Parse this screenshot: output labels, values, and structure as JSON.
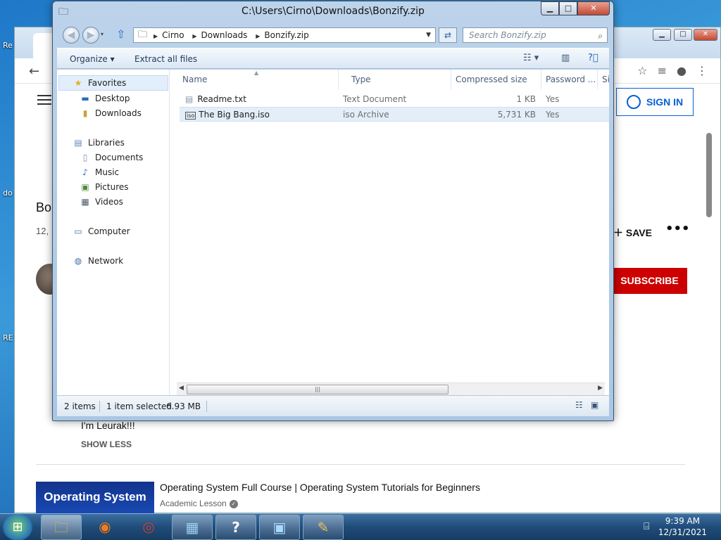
{
  "window": {
    "title": "C:\\Users\\Cirno\\Downloads\\Bonzify.zip",
    "minimize": "▁",
    "maximize": "□",
    "close": "✕"
  },
  "breadcrumb": [
    "Cirno",
    "Downloads",
    "Bonzify.zip"
  ],
  "search": {
    "placeholder": "Search Bonzify.zip"
  },
  "commands": {
    "organize": "Organize ▾",
    "extract_all": "Extract all files"
  },
  "nav": {
    "favorites": "Favorites",
    "desktop": "Desktop",
    "downloads": "Downloads",
    "libraries": "Libraries",
    "documents": "Documents",
    "music": "Music",
    "pictures": "Pictures",
    "videos": "Videos",
    "computer": "Computer",
    "network": "Network"
  },
  "columns": [
    "Name",
    "Type",
    "Compressed size",
    "Password ...",
    "Si"
  ],
  "files": [
    {
      "name": "Readme.txt",
      "type": "Text Document",
      "size": "1 KB",
      "password": "Yes",
      "icon": "text-file-icon"
    },
    {
      "name": "The Big Bang.iso",
      "type": "iso Archive",
      "size": "5,731 KB",
      "password": "Yes",
      "icon": "iso-file-icon"
    }
  ],
  "status": {
    "count": "2 items",
    "selected": "1 item selected",
    "size": "6.93 MB"
  },
  "browser": {
    "sign_in": "SIGN IN",
    "video_title": "Bo",
    "views": "12,",
    "save": "SAVE",
    "subscribe": "SUBSCRIBE",
    "description": "I'm Leurak!!!",
    "show_less": "SHOW LESS",
    "related_title": "Operating System Full Course | Operating System Tutorials for Beginners",
    "related_channel": "Academic Lesson",
    "thumbnail_text": "Operating System"
  },
  "taskbar": {
    "time": "9:39 AM",
    "date": "12/31/2021"
  },
  "colors": {
    "accent": "#065fd4",
    "subscribe": "#cc0000",
    "selection": "#e4eef9"
  }
}
